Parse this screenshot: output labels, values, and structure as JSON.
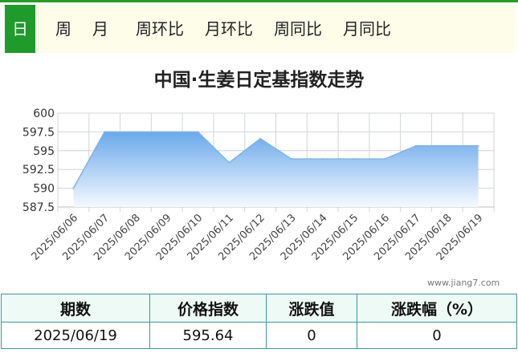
{
  "tabs": [
    {
      "label": "日",
      "active": true
    },
    {
      "label": "周"
    },
    {
      "label": "月"
    },
    {
      "label": "周环比"
    },
    {
      "label": "月环比"
    },
    {
      "label": "周同比"
    },
    {
      "label": "月同比"
    }
  ],
  "chart_data": {
    "type": "area",
    "title": "中国·生姜日定基指数走势",
    "x": [
      "2025/06/06",
      "2025/06/07",
      "2025/06/08",
      "2025/06/09",
      "2025/06/10",
      "2025/06/11",
      "2025/06/12",
      "2025/06/13",
      "2025/06/14",
      "2025/06/15",
      "2025/06/16",
      "2025/06/17",
      "2025/06/18",
      "2025/06/19"
    ],
    "values": [
      590.0,
      597.5,
      597.5,
      597.5,
      597.5,
      593.4,
      596.6,
      593.9,
      593.9,
      593.9,
      593.9,
      595.64,
      595.64,
      595.64
    ],
    "yticks": [
      "600",
      "597.5",
      "595",
      "592.5",
      "590",
      "587.5"
    ],
    "ylim": [
      587.5,
      600
    ],
    "grid": true,
    "colors": {
      "line": "#7fb4e6",
      "fill_top": "#6aa8ea",
      "fill_bottom": "#f4f9ff",
      "grid": "#d0d4da"
    }
  },
  "watermark": "www.jiang7.com",
  "table": {
    "headers": [
      "期数",
      "价格指数",
      "涨跌值",
      "涨跌幅（%）"
    ],
    "row": [
      "2025/06/19",
      "595.64",
      "0",
      "0"
    ]
  }
}
